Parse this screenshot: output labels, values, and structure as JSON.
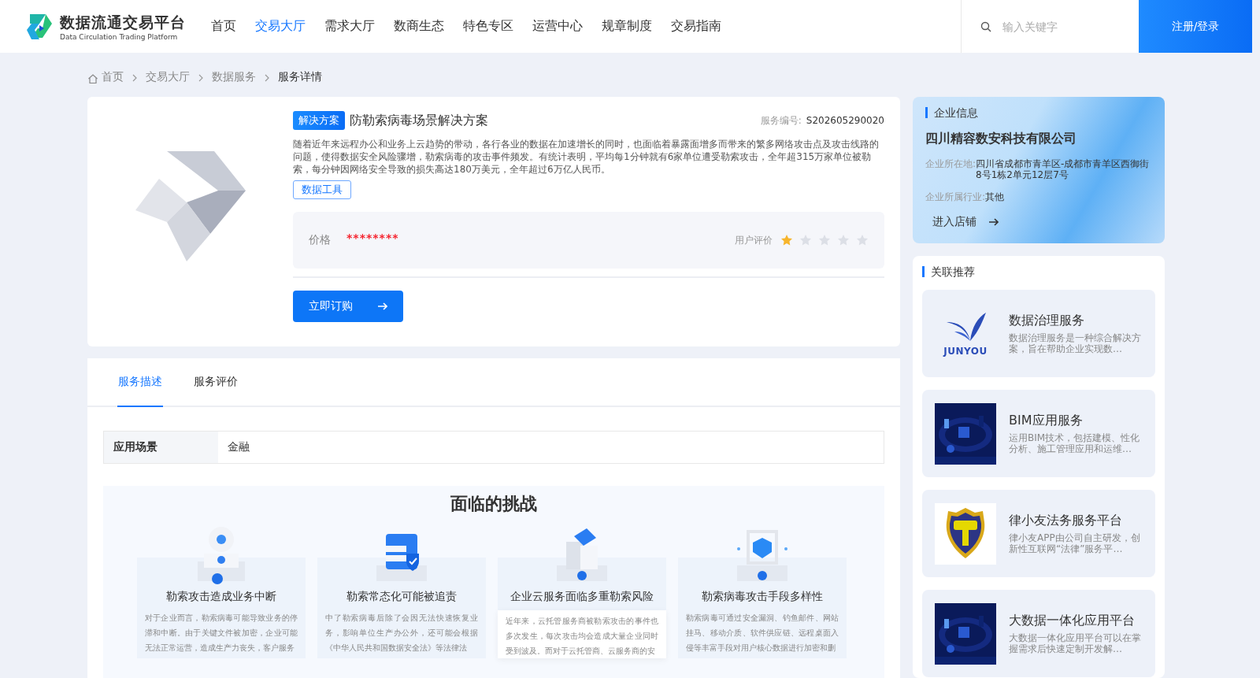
{
  "header": {
    "logo_title": "数据流通交易平台",
    "logo_subtitle": "Data Circulation Trading Platform",
    "nav": [
      {
        "label": "首页",
        "selected": false
      },
      {
        "label": "交易大厅",
        "selected": true
      },
      {
        "label": "需求大厅",
        "selected": false
      },
      {
        "label": "数商生态",
        "selected": false
      },
      {
        "label": "特色专区",
        "selected": false
      },
      {
        "label": "运营中心",
        "selected": false
      },
      {
        "label": "规章制度",
        "selected": false
      },
      {
        "label": "交易指南",
        "selected": false
      }
    ],
    "search": {
      "placeholder": "输入关键字"
    },
    "login_button": "注册/登录"
  },
  "breadcrumb": [
    "首页",
    "交易大厅",
    "数据服务",
    "服务详情"
  ],
  "service": {
    "tag": "解决方案",
    "title": "防勒索病毒场景解决方案",
    "number_label": "服务编号:",
    "number": "S202605290020",
    "description": "随着近年来远程办公和业务上云趋势的带动，各行各业的数据在加速增长的同时，也面临着暴露面增多而带来的繁多网络攻击点及攻击线路的问题，使得数据安全风险骤增，勒索病毒的攻击事件频发。有统计表明，平均每1分钟就有6家单位遭受勒索攻击，全年超315万家单位被勒索，每分钟因网络安全导致的损失高达180万美元，全年超过6万亿人民币。",
    "tool_tag": "数据工具",
    "price_label": "价格",
    "price": "********",
    "rating_label": "用户评价",
    "stars": 1,
    "order_button": "立即订购"
  },
  "tabs": [
    {
      "label": "服务描述",
      "selected": true
    },
    {
      "label": "服务评价",
      "selected": false
    }
  ],
  "details": [
    {
      "label": "应用场景",
      "value": "金融"
    }
  ],
  "challenges": {
    "title": "面临的挑战",
    "items": [
      {
        "title": "勒索攻击造成业务中断",
        "text": "对于企业而言，勒索病毒可能导致业务的停滞和中断。由于关键文件被加密，企业可能无法正常运营，造成生产力丧失，客户服务",
        "highlighted": false
      },
      {
        "title": "勒索常态化可能被追责",
        "text": "中了勒索病毒后除了会因无法快速恢复业务，影响单位生产办公外，还可能会根据《中华人民共和国数据安全法》等法律法",
        "highlighted": false
      },
      {
        "title": "企业云服务面临多重勒索风险",
        "text": "近年来，云托管服务商被勒索攻击的事件也多次发生，每次攻击均会造成大量企业同时受到波及。而对于云托管商、云服务商的安",
        "highlighted": true
      },
      {
        "title": "勒索病毒攻击手段多样性",
        "text": "勒索病毒可通过安全漏洞、钓鱼邮件、网站挂马、移动介质、软件供应链、远程桌面入侵等丰富手段对用户核心数据进行加密和删",
        "highlighted": false
      }
    ]
  },
  "company": {
    "heading": "企业信息",
    "name": "四川精容数安科技有限公司",
    "fields": [
      {
        "label": "企业所在地:",
        "value": "四川省成都市青羊区-成都市青羊区西御街8号1栋2单元12层7号"
      },
      {
        "label": "企业所属行业:",
        "value": "其他"
      }
    ],
    "shop_link": "进入店铺"
  },
  "related": {
    "heading": "关联推荐",
    "items": [
      {
        "kind": "logo",
        "logo_text": "JUNYOU",
        "title": "数据治理服务",
        "summary": "数据治理服务是一种综合解决方案，旨在帮助企业实现数…"
      },
      {
        "kind": "picture",
        "title": "BIM应用服务",
        "summary": "运用BIM技术，包括建模、性化分析、施工管理应用和运维…"
      },
      {
        "kind": "badge",
        "title": "律小友法务服务平台",
        "summary": "律小友APP由公司自主研发，创新性互联网“法律”服务平…"
      },
      {
        "kind": "picture",
        "title": "大数据一体化应用平台",
        "summary": "大数据一体化应用平台可以在掌握需求后快速定制开发解…"
      }
    ]
  }
}
